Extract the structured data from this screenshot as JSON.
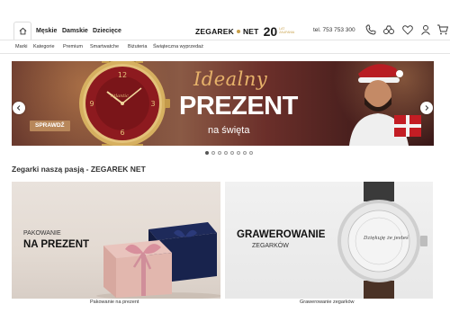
{
  "header": {
    "home_icon": "home-icon",
    "gender_tabs": [
      "Męskie",
      "Damskie",
      "Dziecięce"
    ],
    "logo": {
      "name": "ZEGAREK",
      "suffix": "NET",
      "years": "20",
      "tagline_1": "LAT",
      "tagline_2": "ZAUFANIA"
    },
    "phone": "tel. 753 753 300",
    "icons": [
      "store-icon",
      "compare-icon",
      "wishlist-icon",
      "user-icon",
      "cart-icon"
    ]
  },
  "catnav": {
    "items": [
      "Marki",
      "Kategorie",
      "Premium",
      "Smartwatche",
      "Biżuteria",
      "Świąteczna wyprzedaż"
    ]
  },
  "hero": {
    "title_script": "Idealny",
    "title_main": "PREZENT",
    "title_sub": "na święta",
    "cta_label": "SPRAWDŹ",
    "watch_brand": "Atlantic",
    "slides_total": 8,
    "active_slide": 1
  },
  "section": {
    "title": "Zegarki naszą pasją - ZEGAREK NET"
  },
  "tiles": [
    {
      "small": "PAKOWANIE",
      "big": "NA PREZENT",
      "caption": "Pakowanie na prezent"
    },
    {
      "big": "GRAWEROWANIE",
      "small": "ZEGARKÓW",
      "caption": "Grawerowanie zegarków",
      "engraving": "Dziękuję że jesteś"
    }
  ],
  "colors": {
    "gold": "#c8a04a",
    "hero_script": "#e7b26a",
    "cta": "#b8875a"
  }
}
